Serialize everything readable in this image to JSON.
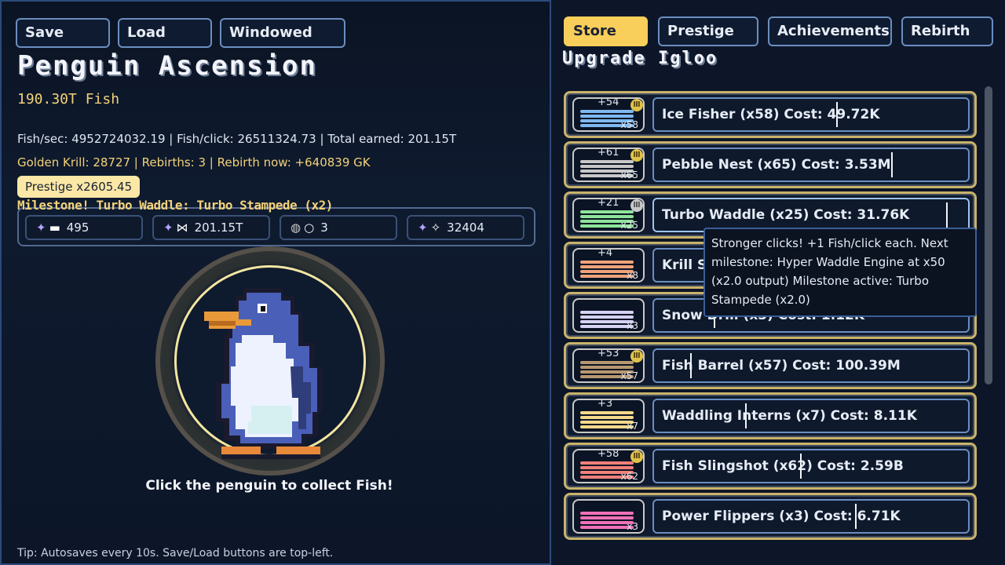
{
  "toolbar": {
    "save": "Save",
    "load": "Load",
    "windowed": "Windowed"
  },
  "game": {
    "title": "Penguin Ascension",
    "fish": "190.30T Fish",
    "rates": "Fish/sec: 4952724032.19  |  Fish/click: 26511324.73  |  Total earned: 201.15T",
    "krill": "Golden Krill: 28727  |  Rebirths: 3  |  Rebirth now: +640839 GK",
    "prestige": "Prestige x2605.45",
    "milestone": "Milestone! Turbo Waddle: Turbo Stampede (x2)",
    "resources": [
      {
        "value": "495",
        "icon": "krill-icon",
        "icon2": "train-icon"
      },
      {
        "value": "201.15T",
        "icon": "krill-icon",
        "icon2": "fish-icon"
      },
      {
        "value": "3",
        "icon": "coin-icon",
        "icon2": "ring-icon"
      },
      {
        "value": "32404",
        "icon": "krill-icon",
        "icon2": "sparkle-icon"
      }
    ],
    "click_hint": "Click the penguin to collect Fish!",
    "tip": "Tip: Autosaves every 10s. Save/Load buttons are top-left."
  },
  "tabs": {
    "store": "Store",
    "prestige": "Prestige",
    "achievements": "Achievements",
    "rebirth": "Rebirth"
  },
  "store": {
    "title": "Upgrade Igloo",
    "items": [
      {
        "label": "Ice Fisher  (x58)  Cost: 49.72K",
        "plus": "+54",
        "mult": "x58",
        "color": "#7fb8f0",
        "coin": "gold"
      },
      {
        "label": "Pebble Nest  (x65)  Cost: 3.53M",
        "plus": "+61",
        "mult": "x65",
        "color": "#c8c8c8",
        "coin": "gold"
      },
      {
        "label": "Turbo Waddle  (x25)  Cost: 31.76K",
        "plus": "+21",
        "mult": "x25",
        "color": "#8fe39a",
        "coin": "grey"
      },
      {
        "label": "Krill S",
        "plus": "+4",
        "mult": "x8",
        "color": "#f0a37a",
        "coin": ""
      },
      {
        "label": "Snow Drill  (x3)  Cost: 1.12K",
        "plus": "",
        "mult": "x3",
        "color": "#d6d2f2",
        "coin": ""
      },
      {
        "label": "Fish Barrel  (x57)  Cost: 100.39M",
        "plus": "+53",
        "mult": "x57",
        "color": "#b89870",
        "coin": "gold"
      },
      {
        "label": "Waddling Interns  (x7)  Cost: 8.11K",
        "plus": "+3",
        "mult": "x7",
        "color": "#f5d98a",
        "coin": ""
      },
      {
        "label": "Fish Slingshot  (x62)  Cost: 2.59B",
        "plus": "+58",
        "mult": "x62",
        "color": "#f0807a",
        "coin": "gold"
      },
      {
        "label": "Power Flippers  (x3)  Cost: 6.71K",
        "plus": "",
        "mult": "x3",
        "color": "#f070b8",
        "coin": ""
      }
    ]
  },
  "tooltip": "Stronger clicks! +1 Fish/click each. Next milestone: Hyper Waddle Engine at x50 (x2.0 output) Milestone active: Turbo Stampede (x2.0)"
}
